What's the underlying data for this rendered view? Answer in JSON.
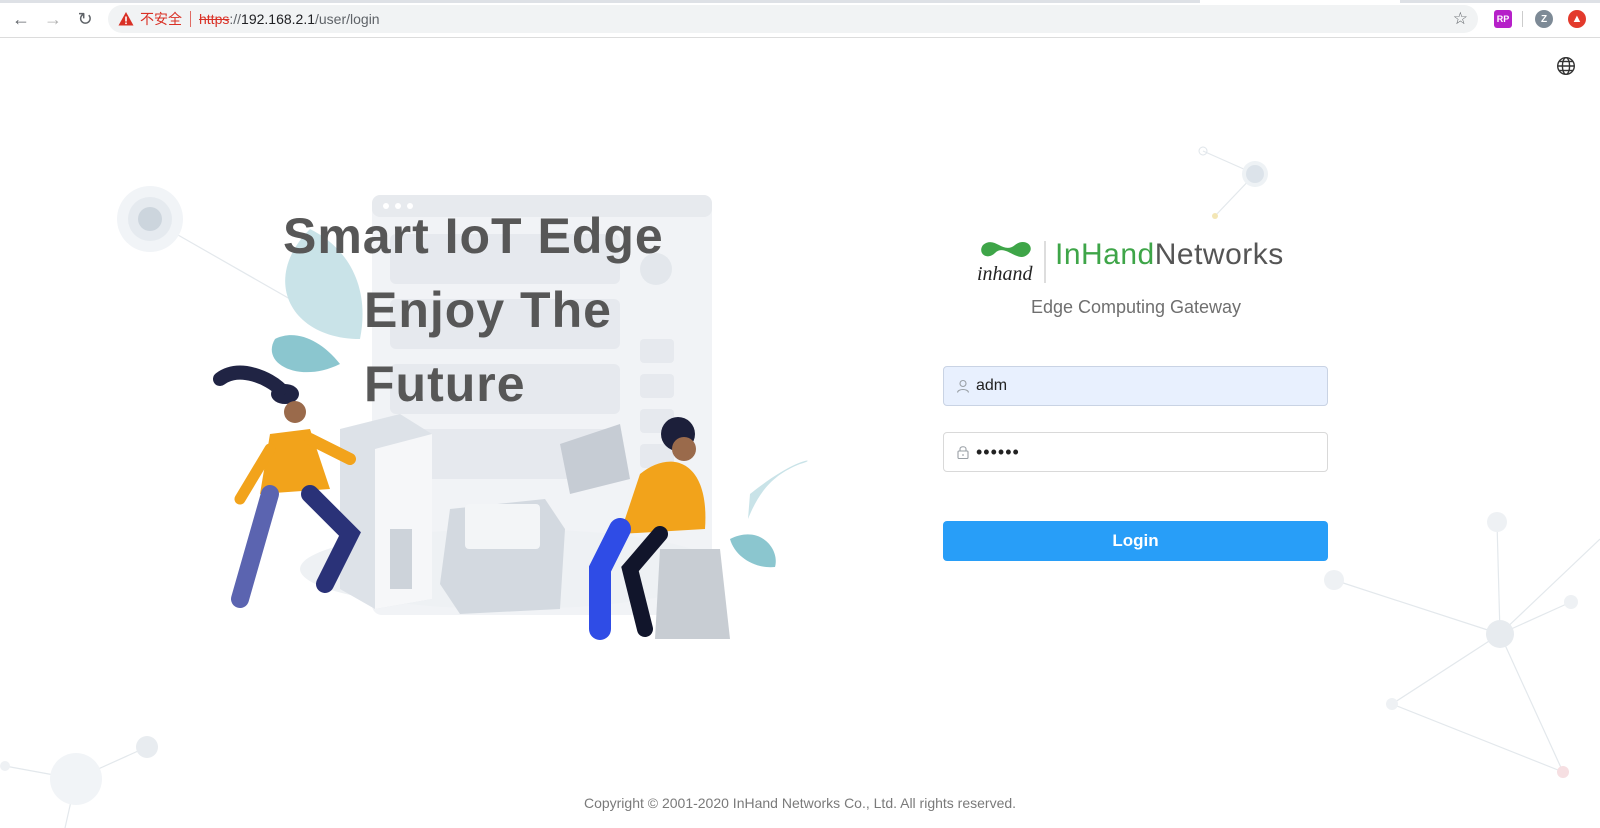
{
  "browser": {
    "insecure_label": "不安全",
    "url_scheme": "https",
    "url_rest": "://",
    "url_host": "192.168.2.1",
    "url_path": "/user/login",
    "ext_rp": "RP",
    "ext_profile": "Z"
  },
  "hero": {
    "line1": "Smart IoT Edge",
    "line2": "Enjoy The",
    "line3": "Future"
  },
  "brand": {
    "logo_text": "inhand",
    "name_green": "InHand",
    "name_gray": "Networks",
    "subtitle": "Edge Computing Gateway"
  },
  "form": {
    "username_value": "adm",
    "password_value": "••••••",
    "login_label": "Login"
  },
  "footer": {
    "copyright": "Copyright © 2001-2020 InHand Networks Co., Ltd. All rights reserved."
  },
  "colors": {
    "accent": "#289ef8",
    "brand_green": "#3ea548",
    "insecure_red": "#d93025"
  }
}
